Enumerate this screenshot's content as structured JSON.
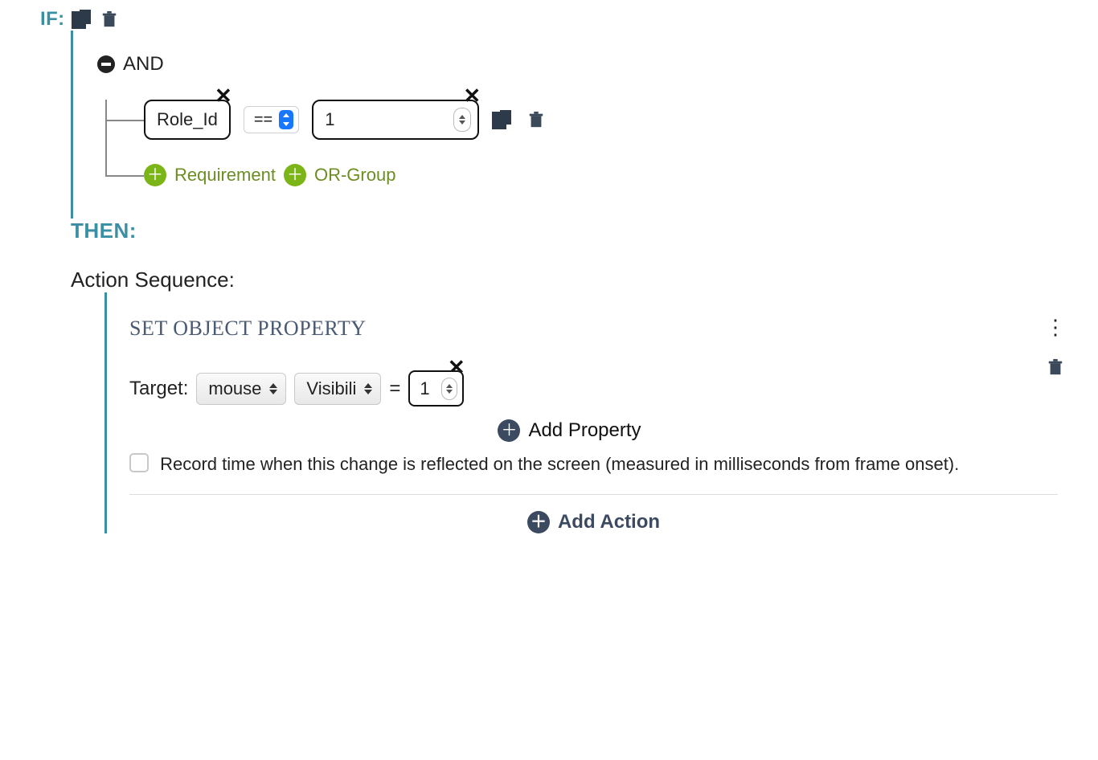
{
  "if": {
    "label": "IF:",
    "operator_label": "AND",
    "condition": {
      "field": "Role_Id",
      "operator": "==",
      "value": "1"
    },
    "add_requirement_label": "Requirement",
    "add_orgroup_label": "OR-Group"
  },
  "then": {
    "label": "THEN:",
    "sequence_label": "Action Sequence:",
    "action": {
      "title": "SET OBJECT PROPERTY",
      "target_label": "Target:",
      "target_value": "mouse",
      "property": "Visibili",
      "equals": "=",
      "value": "1",
      "add_property_label": "Add Property",
      "record_time_label": "Record time when this change is reflected on the screen (measured in milliseconds from frame onset)."
    },
    "add_action_label": "Add Action"
  }
}
